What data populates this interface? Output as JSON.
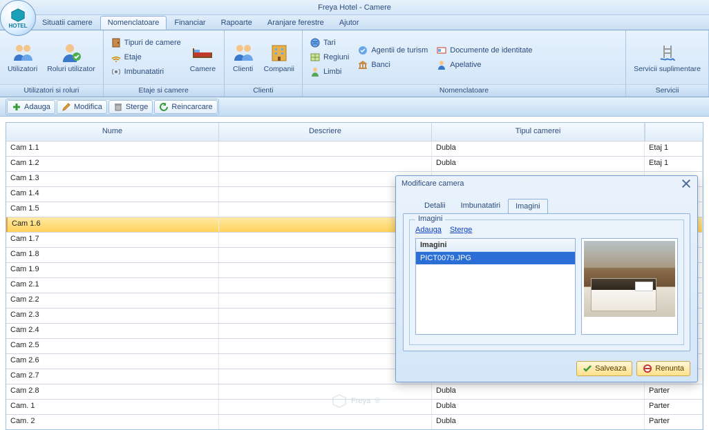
{
  "app_title": "Freya Hotel - Camere",
  "orb_label": "HOTEL",
  "menu": {
    "items": [
      "Situatii camere",
      "Nomenclatoare",
      "Financiar",
      "Rapoarte",
      "Aranjare ferestre",
      "Ajutor"
    ],
    "active": 1
  },
  "ribbon": {
    "groups": [
      {
        "title": "Utilizatori si roluri",
        "big": [
          {
            "label": "Utilizatori"
          },
          {
            "label": "Roluri utilizator"
          }
        ]
      },
      {
        "title": "Etaje si camere",
        "small": [
          {
            "label": "Tipuri de camere"
          },
          {
            "label": "Etaje"
          },
          {
            "label": "Imbunatatiri"
          }
        ],
        "big": [
          {
            "label": "Camere"
          }
        ]
      },
      {
        "title": "Clienti",
        "big": [
          {
            "label": "Clienti"
          },
          {
            "label": "Companii"
          }
        ]
      },
      {
        "title": "Nomenclatoare",
        "cols": [
          [
            {
              "label": "Tari"
            },
            {
              "label": "Regiuni"
            },
            {
              "label": "Limbi"
            }
          ],
          [
            {
              "label": "Agentii de turism"
            },
            {
              "label": "Banci"
            }
          ],
          [
            {
              "label": "Documente de identitate"
            },
            {
              "label": "Apelative"
            }
          ]
        ]
      },
      {
        "title": "Servicii",
        "big": [
          {
            "label": "Servicii suplimentare"
          }
        ]
      }
    ]
  },
  "toolbar": {
    "add": "Adauga",
    "edit": "Modifica",
    "del": "Sterge",
    "reload": "Reincarcare"
  },
  "grid": {
    "headers": {
      "name": "Nume",
      "desc": "Descriere",
      "tip": "Tipul camerei",
      "etaj": ""
    },
    "selected": 5,
    "rows": [
      {
        "name": "Cam 1.1",
        "desc": "",
        "tip": "Dubla",
        "etaj": "Etaj 1"
      },
      {
        "name": "Cam 1.2",
        "desc": "",
        "tip": "Dubla",
        "etaj": "Etaj 1"
      },
      {
        "name": "Cam 1.3",
        "desc": "",
        "tip": "",
        "etaj": ""
      },
      {
        "name": "Cam 1.4",
        "desc": "",
        "tip": "",
        "etaj": ""
      },
      {
        "name": "Cam 1.5",
        "desc": "",
        "tip": "",
        "etaj": ""
      },
      {
        "name": "Cam 1.6",
        "desc": "",
        "tip": "",
        "etaj": ""
      },
      {
        "name": "Cam 1.7",
        "desc": "",
        "tip": "",
        "etaj": ""
      },
      {
        "name": "Cam 1.8",
        "desc": "",
        "tip": "",
        "etaj": ""
      },
      {
        "name": "Cam 1.9",
        "desc": "",
        "tip": "",
        "etaj": ""
      },
      {
        "name": "Cam 2.1",
        "desc": "",
        "tip": "",
        "etaj": ""
      },
      {
        "name": "Cam 2.2",
        "desc": "",
        "tip": "",
        "etaj": ""
      },
      {
        "name": "Cam 2.3",
        "desc": "",
        "tip": "",
        "etaj": ""
      },
      {
        "name": "Cam 2.4",
        "desc": "",
        "tip": "",
        "etaj": ""
      },
      {
        "name": "Cam 2.5",
        "desc": "",
        "tip": "",
        "etaj": ""
      },
      {
        "name": "Cam 2.6",
        "desc": "",
        "tip": "",
        "etaj": ""
      },
      {
        "name": "Cam 2.7",
        "desc": "",
        "tip": "",
        "etaj": ""
      },
      {
        "name": "Cam 2.8",
        "desc": "",
        "tip": "Dubla",
        "etaj": "Parter"
      },
      {
        "name": "Cam. 1",
        "desc": "",
        "tip": "Dubla",
        "etaj": "Parter"
      },
      {
        "name": "Cam. 2",
        "desc": "",
        "tip": "Dubla",
        "etaj": "Parter"
      }
    ]
  },
  "dialog": {
    "title": "Modificare camera",
    "tabs": [
      "Detalii",
      "Imbunatatiri",
      "Imagini"
    ],
    "activeTab": 2,
    "fieldset": "Imagini",
    "links": {
      "add": "Adauga",
      "del": "Sterge"
    },
    "listHeader": "Imagini",
    "items": [
      "PICT0079.JPG"
    ],
    "save": "Salveaza",
    "cancel": "Renunta"
  },
  "watermark": "Freya"
}
